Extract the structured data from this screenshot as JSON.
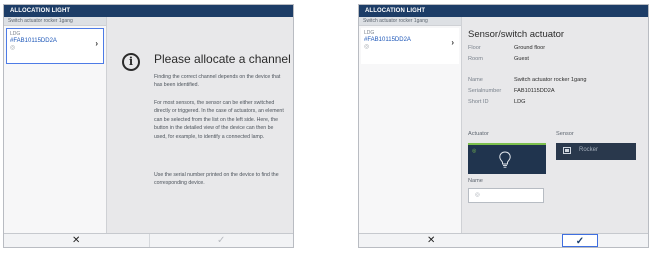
{
  "left_panel": {
    "title": "ALLOCATION LIGHT",
    "sidebar_header": "Switch actuator rocker 1gang",
    "device": {
      "abbr": "LDG",
      "serial": "#FAB10115DD2A",
      "status_icon": "◎",
      "chevron": "›"
    },
    "main": {
      "heading": "Please allocate a channel",
      "info_icon": "i",
      "paragraphs": [
        "Finding the correct channel depends on the device that has been identified.",
        "For most sensors, the sensor can be either switched directly or triggered. In the case of actuators, an element can be selected from the list on the left side. Here, the button in the detailed view of the device can then be used, for example, to identify a connected lamp.",
        "Use the serial number printed on the device to find the corresponding device."
      ]
    },
    "footer": {
      "cancel": "✕",
      "confirm": "✓"
    }
  },
  "right_panel": {
    "title": "ALLOCATION LIGHT",
    "sidebar_header": "Switch actuator rocker 1gang",
    "device": {
      "abbr": "LDG",
      "serial": "#FAB10115DD2A",
      "status_icon": "◎",
      "chevron": "›"
    },
    "detail": {
      "title": "Sensor/switch actuator",
      "props": [
        {
          "key": "Floor",
          "value": "Ground floor"
        },
        {
          "key": "Room",
          "value": "Guest"
        },
        {
          "key": "Name",
          "value": "Switch actuator rocker 1gang"
        },
        {
          "key": "Serialnumber",
          "value": "FAB10115DD2A"
        },
        {
          "key": "Short ID",
          "value": "LDG"
        }
      ],
      "actuator_label": "Actuator",
      "sensor_label": "Sensor",
      "actuator_dot": "◎",
      "sensor_button": "Rocker",
      "name_label": "Name",
      "name_input_icon": "◎"
    },
    "footer": {
      "cancel": "✕",
      "confirm": "✓"
    }
  },
  "colors": {
    "titlebar": "#1d3d67",
    "selection": "#4d7be6",
    "actuator_bg": "#20344e",
    "accent_green": "#7dc04d"
  },
  "icons": [
    "info-icon",
    "chevron-right-icon",
    "close-icon",
    "checkmark-icon",
    "bulb-icon",
    "rocker-icon"
  ]
}
